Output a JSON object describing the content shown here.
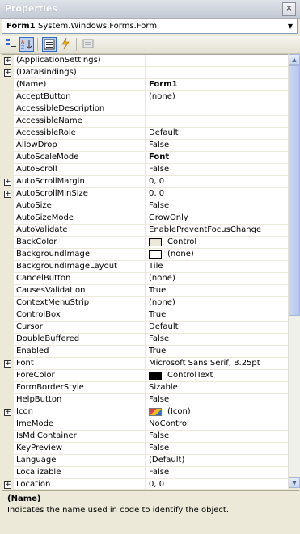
{
  "window": {
    "title": "Properties",
    "close_glyph": "×"
  },
  "object_selector": {
    "name": "Form1",
    "type": "System.Windows.Forms.Form"
  },
  "toolbar": {
    "buttons": [
      "categorized-icon",
      "alphabetical-icon",
      "properties-icon",
      "events-icon",
      "property-pages-icon"
    ]
  },
  "properties": [
    {
      "name": "(ApplicationSettings)",
      "value": "",
      "expandable": true
    },
    {
      "name": "(DataBindings)",
      "value": "",
      "expandable": true
    },
    {
      "name": "(Name)",
      "value": "Form1",
      "bold": true
    },
    {
      "name": "AcceptButton",
      "value": "(none)"
    },
    {
      "name": "AccessibleDescription",
      "value": ""
    },
    {
      "name": "AccessibleName",
      "value": ""
    },
    {
      "name": "AccessibleRole",
      "value": "Default"
    },
    {
      "name": "AllowDrop",
      "value": "False"
    },
    {
      "name": "AutoScaleMode",
      "value": "Font",
      "bold": true
    },
    {
      "name": "AutoScroll",
      "value": "False"
    },
    {
      "name": "AutoScrollMargin",
      "value": "0, 0",
      "expandable": true
    },
    {
      "name": "AutoScrollMinSize",
      "value": "0, 0",
      "expandable": true
    },
    {
      "name": "AutoSize",
      "value": "False"
    },
    {
      "name": "AutoSizeMode",
      "value": "GrowOnly"
    },
    {
      "name": "AutoValidate",
      "value": "EnablePreventFocusChange"
    },
    {
      "name": "BackColor",
      "value": "Control",
      "swatch": "#ece9d8"
    },
    {
      "name": "BackgroundImage",
      "value": "(none)",
      "swatch": "#ffffff"
    },
    {
      "name": "BackgroundImageLayout",
      "value": "Tile"
    },
    {
      "name": "CancelButton",
      "value": "(none)"
    },
    {
      "name": "CausesValidation",
      "value": "True"
    },
    {
      "name": "ContextMenuStrip",
      "value": "(none)"
    },
    {
      "name": "ControlBox",
      "value": "True"
    },
    {
      "name": "Cursor",
      "value": "Default"
    },
    {
      "name": "DoubleBuffered",
      "value": "False"
    },
    {
      "name": "Enabled",
      "value": "True"
    },
    {
      "name": "Font",
      "value": "Microsoft Sans Serif, 8.25pt",
      "expandable": true
    },
    {
      "name": "ForeColor",
      "value": "ControlText",
      "swatch": "#000000"
    },
    {
      "name": "FormBorderStyle",
      "value": "Sizable"
    },
    {
      "name": "HelpButton",
      "value": "False"
    },
    {
      "name": "Icon",
      "value": "(Icon)",
      "expandable": true,
      "icon": true
    },
    {
      "name": "ImeMode",
      "value": "NoControl"
    },
    {
      "name": "IsMdiContainer",
      "value": "False"
    },
    {
      "name": "KeyPreview",
      "value": "False"
    },
    {
      "name": "Language",
      "value": "(Default)"
    },
    {
      "name": "Localizable",
      "value": "False"
    },
    {
      "name": "Location",
      "value": "0, 0",
      "expandable": true
    }
  ],
  "description": {
    "title": "(Name)",
    "text": "Indicates the name used in code to identify the object."
  }
}
